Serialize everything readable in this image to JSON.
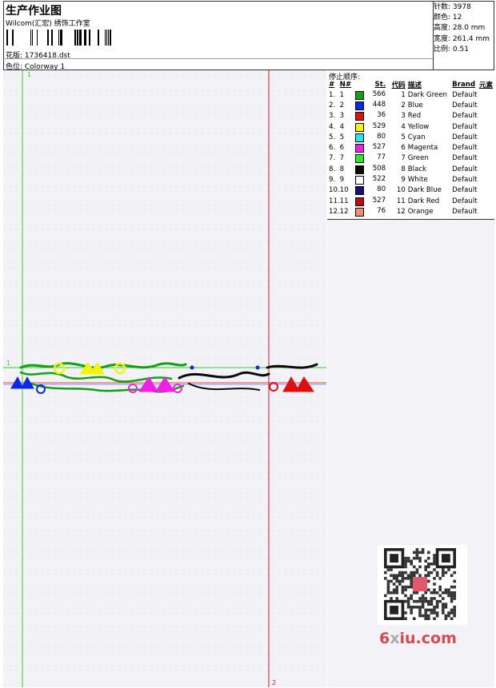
{
  "header": {
    "title": "生产作业图",
    "subtitle": "Wilcom(汇宏) 绣饰工作室",
    "design": "花版: 1736418.dst",
    "colorway": "色位: Colorway 1"
  },
  "stats": [
    "针数: 3978",
    "颜色: 12",
    "高度: 28.0 mm",
    "宽度: 261.4 mm",
    "比例: 0.51"
  ],
  "markers": {
    "v1": "1",
    "v2": "2",
    "h1": "1"
  },
  "stop_sequence": {
    "title": "停止顺序:",
    "headers": [
      "#",
      "N#",
      "St.",
      "代码",
      "描述",
      "Brand",
      "元素"
    ],
    "rows": [
      {
        "idx": "1.",
        "n": "1",
        "color": "#12a112",
        "st": "566",
        "code": "1",
        "desc": "Dark Green",
        "brand": "Default"
      },
      {
        "idx": "2.",
        "n": "2",
        "color": "#0a28e6",
        "st": "448",
        "code": "2",
        "desc": "Blue",
        "brand": "Default"
      },
      {
        "idx": "3.",
        "n": "3",
        "color": "#e01010",
        "st": "36",
        "code": "3",
        "desc": "Red",
        "brand": "Default"
      },
      {
        "idx": "4.",
        "n": "4",
        "color": "#f4f40a",
        "st": "529",
        "code": "4",
        "desc": "Yellow",
        "brand": "Default"
      },
      {
        "idx": "5.",
        "n": "5",
        "color": "#1ee8f0",
        "st": "80",
        "code": "5",
        "desc": "Cyan",
        "brand": "Default"
      },
      {
        "idx": "6.",
        "n": "6",
        "color": "#f020e8",
        "st": "527",
        "code": "6",
        "desc": "Magenta",
        "brand": "Default"
      },
      {
        "idx": "7.",
        "n": "7",
        "color": "#2ae82a",
        "st": "77",
        "code": "7",
        "desc": "Green",
        "brand": "Default"
      },
      {
        "idx": "8.",
        "n": "8",
        "color": "#0a0a0a",
        "st": "508",
        "code": "8",
        "desc": "Black",
        "brand": "Default"
      },
      {
        "idx": "9.",
        "n": "9",
        "color": "#ffffff",
        "st": "522",
        "code": "9",
        "desc": "White",
        "brand": "Default"
      },
      {
        "idx": "10.",
        "n": "10",
        "color": "#12127a",
        "st": "80",
        "code": "10",
        "desc": "Dark Blue",
        "brand": "Default"
      },
      {
        "idx": "11.",
        "n": "11",
        "color": "#b80e0e",
        "st": "527",
        "code": "11",
        "desc": "Dark Red",
        "brand": "Default"
      },
      {
        "idx": "12.",
        "n": "12",
        "color": "#f08c78",
        "st": "76",
        "code": "12",
        "desc": "Orange",
        "brand": "Default"
      }
    ]
  },
  "watermark": {
    "part1": "6",
    "part2": "x",
    "part3": "iu.com"
  }
}
